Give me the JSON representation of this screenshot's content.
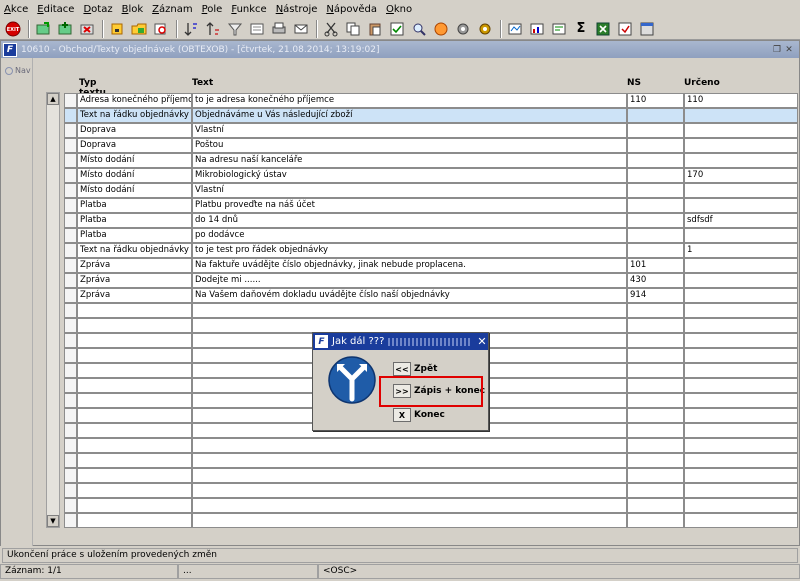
{
  "menu": [
    "Akce",
    "Editace",
    "Dotaz",
    "Blok",
    "Záznam",
    "Pole",
    "Funkce",
    "Nástroje",
    "Nápověda",
    "Okno"
  ],
  "menu_underline": [
    "A",
    "E",
    "D",
    "B",
    "Z",
    "P",
    "F",
    "N",
    "N",
    "O"
  ],
  "toolbar": {
    "exit_label": "EXIT",
    "icons": [
      "exit-icon",
      "save-icon",
      "new-record-icon",
      "delete-record-icon",
      "lock-icon",
      "folder-open-icon",
      "search-icon",
      "sort-asc-icon",
      "sort-desc-icon",
      "filter-icon",
      "query-icon",
      "print-icon",
      "mail-icon",
      "cut-icon",
      "copy-icon",
      "paste-icon",
      "check-icon",
      "find-icon",
      "calendar-icon",
      "settings-icon",
      "gear-icon",
      "refresh-icon",
      "chart-icon",
      "zoom-icon",
      "sum-icon",
      "excel-icon",
      "help-icon",
      "window-icon"
    ]
  },
  "window": {
    "title": "10610 - Obchod/Texty objednávek (OBTEXOB) - [čtvrtek, 21.08.2014; 13:19:02]",
    "logo": "F"
  },
  "nav": {
    "label": "Nav"
  },
  "grid": {
    "headers": [
      "Typ textu",
      "Text",
      "NS",
      "Určeno"
    ],
    "rows": [
      [
        "Adresa konečného příjemce",
        "to je adresa konečného příjemce",
        "110",
        "110"
      ],
      [
        "Text na řádku objednávky",
        "Objednáváme u Vás následující zboží",
        "",
        ""
      ],
      [
        "Doprava",
        "Vlastní",
        "",
        ""
      ],
      [
        "Doprava",
        "Poštou",
        "",
        ""
      ],
      [
        "Místo dodání",
        "Na adresu naší kanceláře",
        "",
        ""
      ],
      [
        "Místo dodání",
        "Mikrobiologický ústav",
        "",
        "170"
      ],
      [
        "Místo dodání",
        "Vlastní",
        "",
        ""
      ],
      [
        "Platba",
        "Platbu proveďte na náš účet",
        "",
        ""
      ],
      [
        "Platba",
        "do 14 dnů",
        "",
        "sdfsdf"
      ],
      [
        "Platba",
        "po dodávce",
        "",
        ""
      ],
      [
        "Text na řádku objednávky",
        "to je test pro řádek objednávky",
        "",
        "1"
      ],
      [
        "Zpráva",
        "Na faktuře uvádějte číslo objednávky, jinak nebude proplacena.",
        "101",
        ""
      ],
      [
        "Zpráva",
        "Dodejte mi ......",
        "430",
        ""
      ],
      [
        "Zpráva",
        "Na Vašem daňovém dokladu uvádějte číslo naší objednávky",
        "914",
        ""
      ]
    ],
    "selected_row": 1,
    "empty_rows": 15
  },
  "dialog": {
    "title": "Jak dál ???",
    "logo": "F",
    "buttons": [
      {
        "key": "<<",
        "label": "Zpět"
      },
      {
        "key": ">>",
        "label": "Zápis + konec"
      },
      {
        "key": "X",
        "label": "Konec"
      }
    ],
    "highlight_color": "#e00000"
  },
  "status": {
    "message": "Ukončení práce s uložením provedených změn",
    "record": "Záznam: 1/1",
    "ellipsis": "...",
    "mode": "<OSC>"
  }
}
